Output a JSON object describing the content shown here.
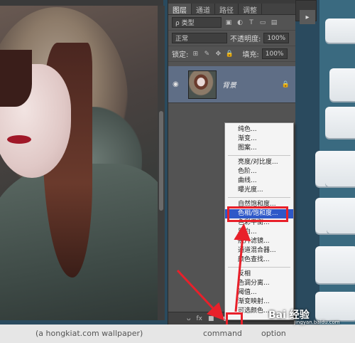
{
  "layers_panel": {
    "tabs": [
      "图层",
      "通道",
      "路径",
      "调整"
    ],
    "filter_kind": "ρ 类型",
    "blend_mode": "正常",
    "opacity_label": "不透明度:",
    "opacity_value": "100%",
    "lock_label": "锁定:",
    "fill_label": "填充:",
    "fill_value": "100%",
    "layer_name": "背景",
    "bottom_icons": [
      "ᴗ",
      "fx",
      "■"
    ]
  },
  "adjustment_menu": {
    "items_group1": [
      "纯色...",
      "渐变...",
      "图案..."
    ],
    "items_group2": [
      "亮度/对比度...",
      "色阶...",
      "曲线...",
      "曝光度..."
    ],
    "items_group3": [
      "自然饱和度...",
      "色相/饱和度...",
      "色彩平衡...",
      "黑白...",
      "照片滤镜...",
      "通道混合器...",
      "颜色查找..."
    ],
    "items_group4": [
      "反相",
      "色调分离...",
      "阈值...",
      "渐变映射...",
      "可选颜色..."
    ],
    "highlighted": "色相/饱和度..."
  },
  "bottom_bar": {
    "wallpaper": "(a hongkiat.com wallpaper)",
    "command": "command",
    "option": "option"
  },
  "watermark": {
    "text": "Bai 经验",
    "sub": "jingyan.baidu.com"
  },
  "colors": {
    "highlight_red": "#e8202a",
    "menu_highlight": "#2e58c8"
  }
}
